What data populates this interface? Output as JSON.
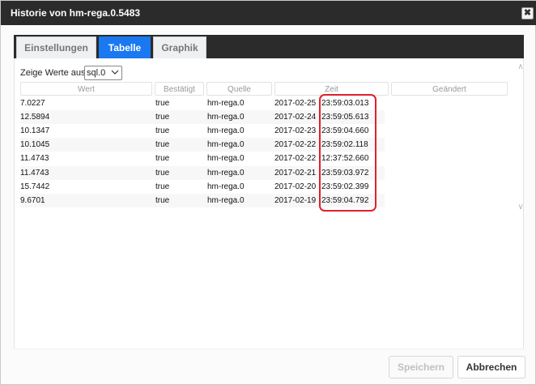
{
  "window": {
    "title": "Historie von hm-rega.0.5483",
    "close_glyph": "✖"
  },
  "tabs": [
    {
      "label": "Einstellungen",
      "active": false
    },
    {
      "label": "Tabelle",
      "active": true
    },
    {
      "label": "Graphik",
      "active": false
    }
  ],
  "filter": {
    "label": "Zeige Werte aus",
    "selected": "sql.0"
  },
  "table": {
    "columns": [
      "Wert",
      "Bestätigt",
      "Quelle",
      "Zeit",
      "Geändert"
    ],
    "rows": [
      {
        "wert": "7.0227",
        "bestaetigt": "true",
        "quelle": "hm-rega.0",
        "datum": "2017-02-25",
        "uhrzeit": "23:59:03.013",
        "geaendert": ""
      },
      {
        "wert": "12.5894",
        "bestaetigt": "true",
        "quelle": "hm-rega.0",
        "datum": "2017-02-24",
        "uhrzeit": "23:59:05.613",
        "geaendert": ""
      },
      {
        "wert": "10.1347",
        "bestaetigt": "true",
        "quelle": "hm-rega.0",
        "datum": "2017-02-23",
        "uhrzeit": "23:59:04.660",
        "geaendert": ""
      },
      {
        "wert": "10.1045",
        "bestaetigt": "true",
        "quelle": "hm-rega.0",
        "datum": "2017-02-22",
        "uhrzeit": "23:59:02.118",
        "geaendert": ""
      },
      {
        "wert": "11.4743",
        "bestaetigt": "true",
        "quelle": "hm-rega.0",
        "datum": "2017-02-22",
        "uhrzeit": "12:37:52.660",
        "geaendert": ""
      },
      {
        "wert": "11.4743",
        "bestaetigt": "true",
        "quelle": "hm-rega.0",
        "datum": "2017-02-21",
        "uhrzeit": "23:59:03.972",
        "geaendert": ""
      },
      {
        "wert": "15.7442",
        "bestaetigt": "true",
        "quelle": "hm-rega.0",
        "datum": "2017-02-20",
        "uhrzeit": "23:59:02.399",
        "geaendert": ""
      },
      {
        "wert": "9.6701",
        "bestaetigt": "true",
        "quelle": "hm-rega.0",
        "datum": "2017-02-19",
        "uhrzeit": "23:59:04.792",
        "geaendert": ""
      }
    ]
  },
  "buttons": {
    "save": "Speichern",
    "cancel": "Abbrechen"
  },
  "colors": {
    "titlebar": "#2b2b2b",
    "active_tab": "#1a78f0",
    "highlight": "#e0202a"
  },
  "icons": {
    "close": "close-icon",
    "dropdown": "chevron-down-icon",
    "scroll_up": "scroll-up-icon",
    "scroll_down": "scroll-down-icon"
  }
}
